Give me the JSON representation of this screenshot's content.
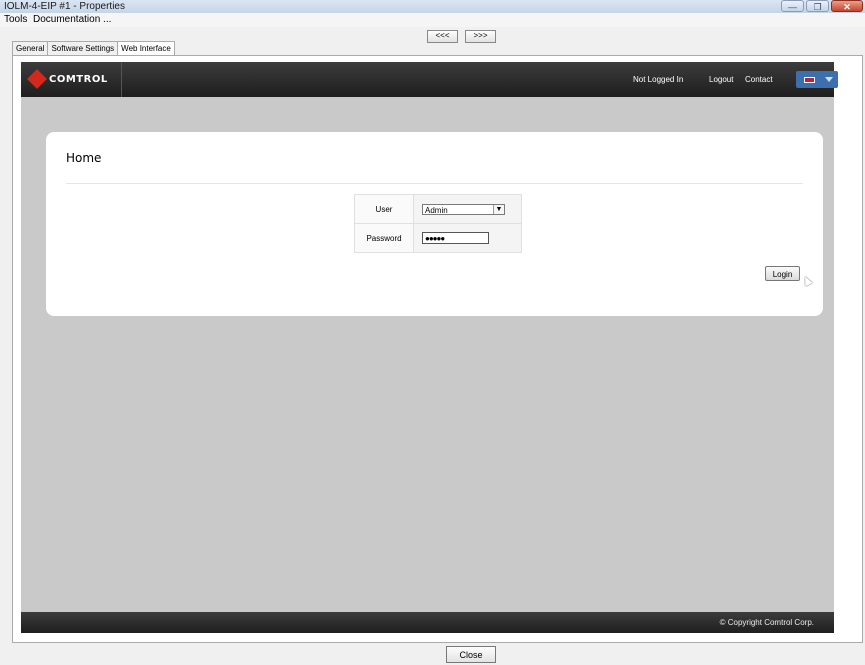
{
  "window": {
    "title": "IOLM-4-EIP #1 - Properties",
    "buttons": {
      "minimize": "—",
      "restore": "❐",
      "close": "✕"
    }
  },
  "menu": [
    "Tools",
    "Documentation ..."
  ],
  "nav": {
    "prev": "<<<",
    "next": ">>>"
  },
  "tabs": [
    {
      "label": "General",
      "active": false
    },
    {
      "label": "Software Settings",
      "active": false
    },
    {
      "label": "Web Interface",
      "active": true
    }
  ],
  "web": {
    "brand": "COMTROL",
    "header": {
      "status": "Not Logged In",
      "logout": "Logout",
      "contact": "Contact"
    },
    "home": {
      "title": "Home",
      "user_label": "User",
      "user_value": "Admin",
      "password_label": "Password",
      "password_value": "●●●●●",
      "login_label": "Login"
    },
    "footer": {
      "copyright": "© Copyright Comtrol Corp."
    }
  },
  "bottom": {
    "close_label": "Close"
  },
  "colors": {
    "brand_red": "#d4281c",
    "header_dark": "#2a2a2a",
    "lang_blue": "#3c6fae",
    "page_gray": "#c9c9c9"
  }
}
